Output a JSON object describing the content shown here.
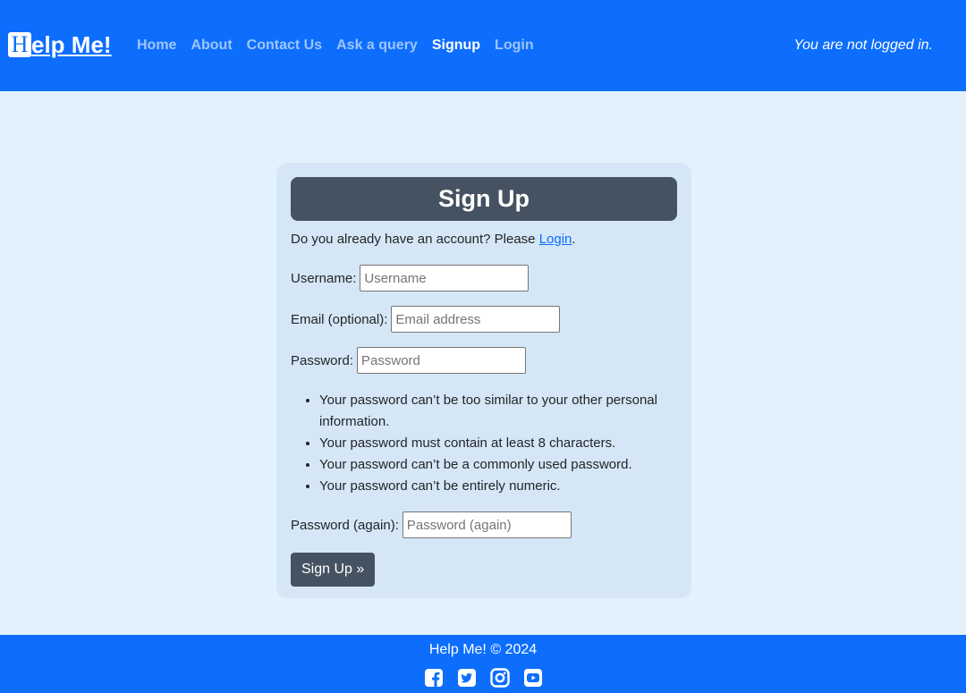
{
  "navbar": {
    "brand_logo_letter": "H",
    "brand_text": "elp Me!",
    "links": [
      {
        "label": "Home",
        "active": false
      },
      {
        "label": "About",
        "active": false
      },
      {
        "label": "Contact Us",
        "active": false
      },
      {
        "label": "Ask a query",
        "active": false
      },
      {
        "label": "Signup",
        "active": true
      },
      {
        "label": "Login",
        "active": false
      }
    ],
    "login_status": "You are not logged in."
  },
  "signup": {
    "title": "Sign Up",
    "intro_text": "Do you already have an account? Please ",
    "intro_link": "Login",
    "intro_suffix": ".",
    "fields": {
      "username": {
        "label": "Username:",
        "placeholder": "Username",
        "value": ""
      },
      "email": {
        "label": "Email (optional):",
        "placeholder": "Email address",
        "value": ""
      },
      "password": {
        "label": "Password:",
        "placeholder": "Password",
        "value": ""
      },
      "password2": {
        "label": "Password (again):",
        "placeholder": "Password (again)",
        "value": ""
      }
    },
    "password_help": [
      "Your password can’t be too similar to your other personal information.",
      "Your password must contain at least 8 characters.",
      "Your password can’t be a commonly used password.",
      "Your password can’t be entirely numeric."
    ],
    "submit_label": "Sign Up »"
  },
  "footer": {
    "text": "Help Me! © 2024",
    "socials": [
      "facebook-icon",
      "twitter-icon",
      "instagram-icon",
      "youtube-icon"
    ]
  },
  "colors": {
    "primary": "#0d6efd",
    "page_bg": "#e3f1fc",
    "card_bg": "#d5e7f6",
    "header_bg": "#455261"
  }
}
